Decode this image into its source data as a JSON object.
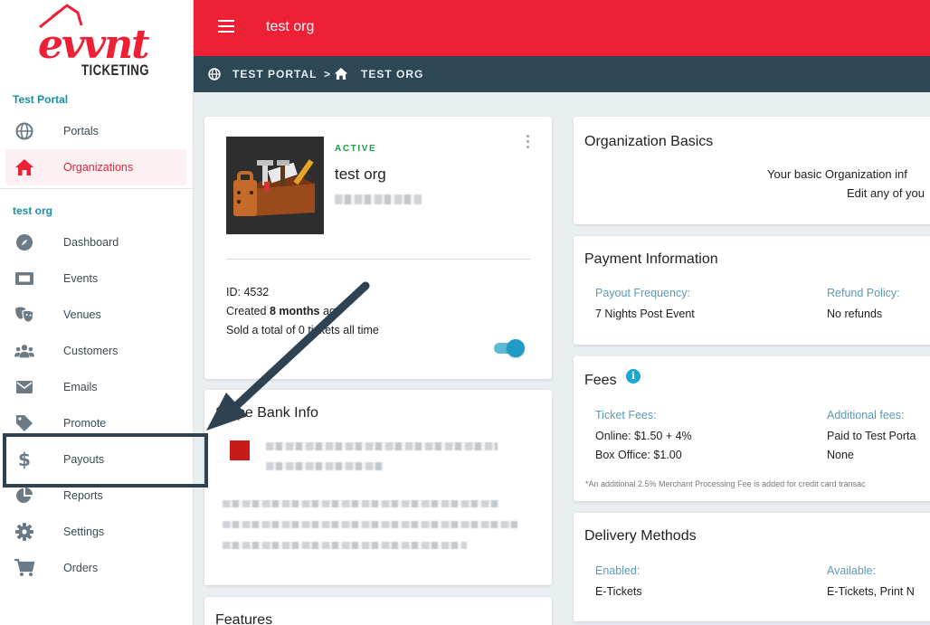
{
  "brand": {
    "logo_word": "evvnt",
    "logo_sub": "TICKETING",
    "accent": "#ee2036",
    "header_dark": "#2d4755",
    "link_blue": "#5b9bb3"
  },
  "sidebar": {
    "section1": "Test Portal",
    "section1_items": [
      {
        "label": "Portals",
        "icon": "globe-icon"
      },
      {
        "label": "Organizations",
        "icon": "home-icon",
        "active": true
      }
    ],
    "section2": "test org",
    "section2_items": [
      {
        "label": "Dashboard",
        "icon": "compass-icon"
      },
      {
        "label": "Events",
        "icon": "ticket-icon"
      },
      {
        "label": "Venues",
        "icon": "theater-masks-icon"
      },
      {
        "label": "Customers",
        "icon": "people-icon"
      },
      {
        "label": "Emails",
        "icon": "envelope-icon"
      },
      {
        "label": "Promote",
        "icon": "tag-icon"
      },
      {
        "label": "Payouts",
        "icon": "dollar-icon"
      },
      {
        "label": "Reports",
        "icon": "pie-chart-icon"
      },
      {
        "label": "Settings",
        "icon": "gear-icon"
      },
      {
        "label": "Orders",
        "icon": "cart-icon"
      }
    ]
  },
  "topbar": {
    "title": "test org"
  },
  "breadcrumb": {
    "portal": "TEST PORTAL",
    "separator": ">",
    "org": "TEST ORG"
  },
  "org_card": {
    "status": "ACTIVE",
    "name": "test org",
    "id_line": "ID: 4532",
    "created_prefix": "Created ",
    "created_bold": "8 months",
    "created_suffix": " ago",
    "sold_line": "Sold a total of 0 tickets all time",
    "enabled": true
  },
  "bank_card": {
    "title": "Stripe Bank Info"
  },
  "features_card": {
    "title": "Features"
  },
  "basics_card": {
    "title": "Organization Basics",
    "line1": "Your basic Organization inf",
    "line2": "Edit any of you"
  },
  "payment_card": {
    "title": "Payment Information",
    "payout_label": "Payout Frequency:",
    "payout_value": "7 Nights Post Event",
    "refund_label": "Refund Policy:",
    "refund_value": "No refunds"
  },
  "fees_card": {
    "title": "Fees",
    "info_glyph": "i",
    "ticket_label": "Ticket Fees:",
    "online": "Online: $1.50 + 4%",
    "box_office": "Box Office: $1.00",
    "additional_label": "Additional fees:",
    "additional_1": "Paid to Test Porta",
    "additional_2": "None",
    "note": "*An additional 2.5% Merchant Processing Fee is added for credit card transac"
  },
  "delivery_card": {
    "title": "Delivery Methods",
    "enabled_label": "Enabled:",
    "enabled_value": "E-Tickets",
    "available_label": "Available:",
    "available_value": "E-Tickets, Print N"
  }
}
